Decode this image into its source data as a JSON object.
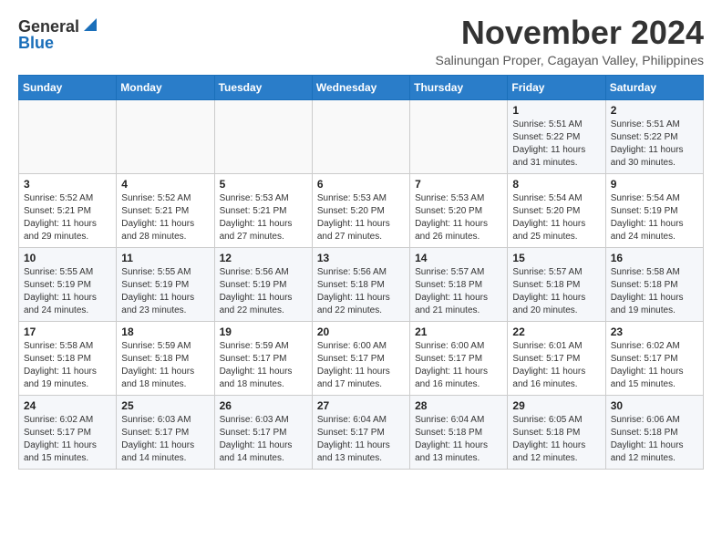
{
  "logo": {
    "general": "General",
    "blue": "Blue"
  },
  "title": "November 2024",
  "subtitle": "Salinungan Proper, Cagayan Valley, Philippines",
  "days_of_week": [
    "Sunday",
    "Monday",
    "Tuesday",
    "Wednesday",
    "Thursday",
    "Friday",
    "Saturday"
  ],
  "weeks": [
    [
      {
        "day": "",
        "info": ""
      },
      {
        "day": "",
        "info": ""
      },
      {
        "day": "",
        "info": ""
      },
      {
        "day": "",
        "info": ""
      },
      {
        "day": "",
        "info": ""
      },
      {
        "day": "1",
        "info": "Sunrise: 5:51 AM\nSunset: 5:22 PM\nDaylight: 11 hours\nand 31 minutes."
      },
      {
        "day": "2",
        "info": "Sunrise: 5:51 AM\nSunset: 5:22 PM\nDaylight: 11 hours\nand 30 minutes."
      }
    ],
    [
      {
        "day": "3",
        "info": "Sunrise: 5:52 AM\nSunset: 5:21 PM\nDaylight: 11 hours\nand 29 minutes."
      },
      {
        "day": "4",
        "info": "Sunrise: 5:52 AM\nSunset: 5:21 PM\nDaylight: 11 hours\nand 28 minutes."
      },
      {
        "day": "5",
        "info": "Sunrise: 5:53 AM\nSunset: 5:21 PM\nDaylight: 11 hours\nand 27 minutes."
      },
      {
        "day": "6",
        "info": "Sunrise: 5:53 AM\nSunset: 5:20 PM\nDaylight: 11 hours\nand 27 minutes."
      },
      {
        "day": "7",
        "info": "Sunrise: 5:53 AM\nSunset: 5:20 PM\nDaylight: 11 hours\nand 26 minutes."
      },
      {
        "day": "8",
        "info": "Sunrise: 5:54 AM\nSunset: 5:20 PM\nDaylight: 11 hours\nand 25 minutes."
      },
      {
        "day": "9",
        "info": "Sunrise: 5:54 AM\nSunset: 5:19 PM\nDaylight: 11 hours\nand 24 minutes."
      }
    ],
    [
      {
        "day": "10",
        "info": "Sunrise: 5:55 AM\nSunset: 5:19 PM\nDaylight: 11 hours\nand 24 minutes."
      },
      {
        "day": "11",
        "info": "Sunrise: 5:55 AM\nSunset: 5:19 PM\nDaylight: 11 hours\nand 23 minutes."
      },
      {
        "day": "12",
        "info": "Sunrise: 5:56 AM\nSunset: 5:19 PM\nDaylight: 11 hours\nand 22 minutes."
      },
      {
        "day": "13",
        "info": "Sunrise: 5:56 AM\nSunset: 5:18 PM\nDaylight: 11 hours\nand 22 minutes."
      },
      {
        "day": "14",
        "info": "Sunrise: 5:57 AM\nSunset: 5:18 PM\nDaylight: 11 hours\nand 21 minutes."
      },
      {
        "day": "15",
        "info": "Sunrise: 5:57 AM\nSunset: 5:18 PM\nDaylight: 11 hours\nand 20 minutes."
      },
      {
        "day": "16",
        "info": "Sunrise: 5:58 AM\nSunset: 5:18 PM\nDaylight: 11 hours\nand 19 minutes."
      }
    ],
    [
      {
        "day": "17",
        "info": "Sunrise: 5:58 AM\nSunset: 5:18 PM\nDaylight: 11 hours\nand 19 minutes."
      },
      {
        "day": "18",
        "info": "Sunrise: 5:59 AM\nSunset: 5:18 PM\nDaylight: 11 hours\nand 18 minutes."
      },
      {
        "day": "19",
        "info": "Sunrise: 5:59 AM\nSunset: 5:17 PM\nDaylight: 11 hours\nand 18 minutes."
      },
      {
        "day": "20",
        "info": "Sunrise: 6:00 AM\nSunset: 5:17 PM\nDaylight: 11 hours\nand 17 minutes."
      },
      {
        "day": "21",
        "info": "Sunrise: 6:00 AM\nSunset: 5:17 PM\nDaylight: 11 hours\nand 16 minutes."
      },
      {
        "day": "22",
        "info": "Sunrise: 6:01 AM\nSunset: 5:17 PM\nDaylight: 11 hours\nand 16 minutes."
      },
      {
        "day": "23",
        "info": "Sunrise: 6:02 AM\nSunset: 5:17 PM\nDaylight: 11 hours\nand 15 minutes."
      }
    ],
    [
      {
        "day": "24",
        "info": "Sunrise: 6:02 AM\nSunset: 5:17 PM\nDaylight: 11 hours\nand 15 minutes."
      },
      {
        "day": "25",
        "info": "Sunrise: 6:03 AM\nSunset: 5:17 PM\nDaylight: 11 hours\nand 14 minutes."
      },
      {
        "day": "26",
        "info": "Sunrise: 6:03 AM\nSunset: 5:17 PM\nDaylight: 11 hours\nand 14 minutes."
      },
      {
        "day": "27",
        "info": "Sunrise: 6:04 AM\nSunset: 5:17 PM\nDaylight: 11 hours\nand 13 minutes."
      },
      {
        "day": "28",
        "info": "Sunrise: 6:04 AM\nSunset: 5:18 PM\nDaylight: 11 hours\nand 13 minutes."
      },
      {
        "day": "29",
        "info": "Sunrise: 6:05 AM\nSunset: 5:18 PM\nDaylight: 11 hours\nand 12 minutes."
      },
      {
        "day": "30",
        "info": "Sunrise: 6:06 AM\nSunset: 5:18 PM\nDaylight: 11 hours\nand 12 minutes."
      }
    ]
  ]
}
